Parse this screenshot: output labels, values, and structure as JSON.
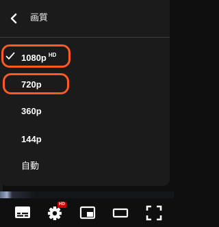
{
  "quality_menu": {
    "title": "画質",
    "options": [
      {
        "label": "1080p",
        "badge": "HD",
        "selected": true,
        "highlighted": true
      },
      {
        "label": "720p",
        "selected": false,
        "highlighted": true
      },
      {
        "label": "360p",
        "selected": false,
        "highlighted": false
      },
      {
        "label": "144p",
        "selected": false,
        "highlighted": false
      },
      {
        "label": "自動",
        "selected": false,
        "highlighted": false
      }
    ]
  },
  "controls": {
    "items": [
      "subtitles-icon",
      "settings-gear-icon",
      "miniplayer-icon",
      "theater-mode-icon",
      "fullscreen-icon"
    ],
    "settings_badge": "HD"
  },
  "colors": {
    "menu_background": "#1c1c1c",
    "highlight_outline": "#ff5a1f",
    "hd_badge": "#cc0000"
  }
}
